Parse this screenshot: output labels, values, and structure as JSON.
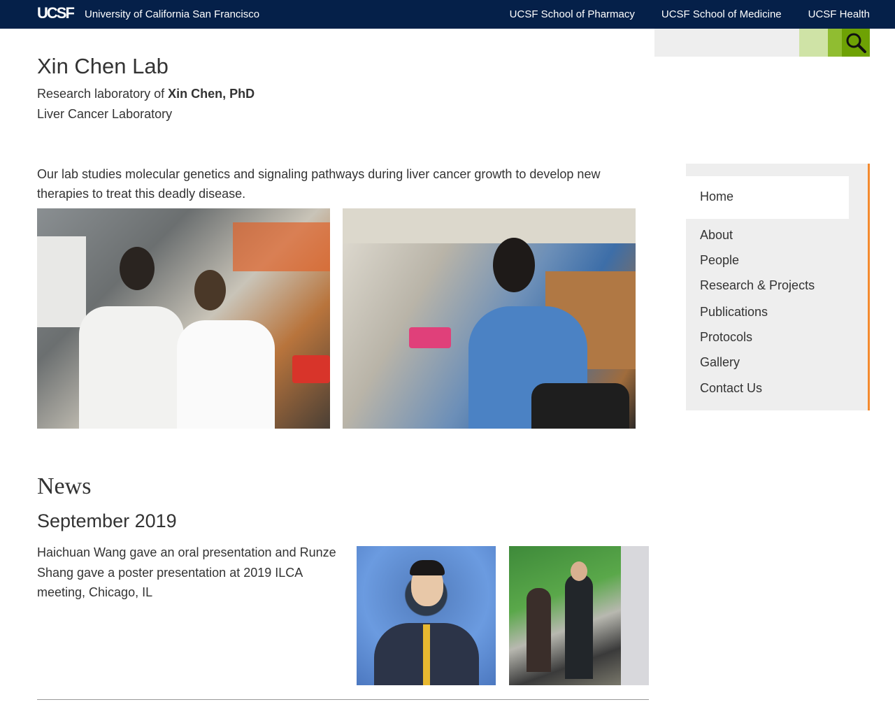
{
  "topbar": {
    "logo": "UCSF",
    "university": "University of California San Francisco",
    "links": [
      "UCSF School of Pharmacy",
      "UCSF School of Medicine",
      "UCSF Health"
    ]
  },
  "search": {
    "placeholder": "",
    "icon": "search-icon"
  },
  "header": {
    "title": "Xin Chen Lab",
    "subtitle_prefix": "Research laboratory of ",
    "subtitle_name": "Xin Chen, PhD",
    "subtitle2": "Liver Cancer Laboratory"
  },
  "intro": "Our lab studies molecular genetics and signaling pathways during liver cancer growth to develop new therapies to treat this deadly disease.",
  "nav": {
    "items": [
      "Home",
      "About",
      "People",
      "Research & Projects",
      "Publications",
      "Protocols",
      "Gallery",
      "Contact Us"
    ],
    "active": "Home"
  },
  "news": {
    "title": "News",
    "date": "September 2019",
    "text": "Haichuan Wang gave an oral presentation and Runze Shang gave a poster presentation at 2019 ILCA meeting, Chicago, IL"
  },
  "colors": {
    "topbar": "#052049",
    "accent_orange": "#f48a2e",
    "search_green": "#6ea204"
  }
}
